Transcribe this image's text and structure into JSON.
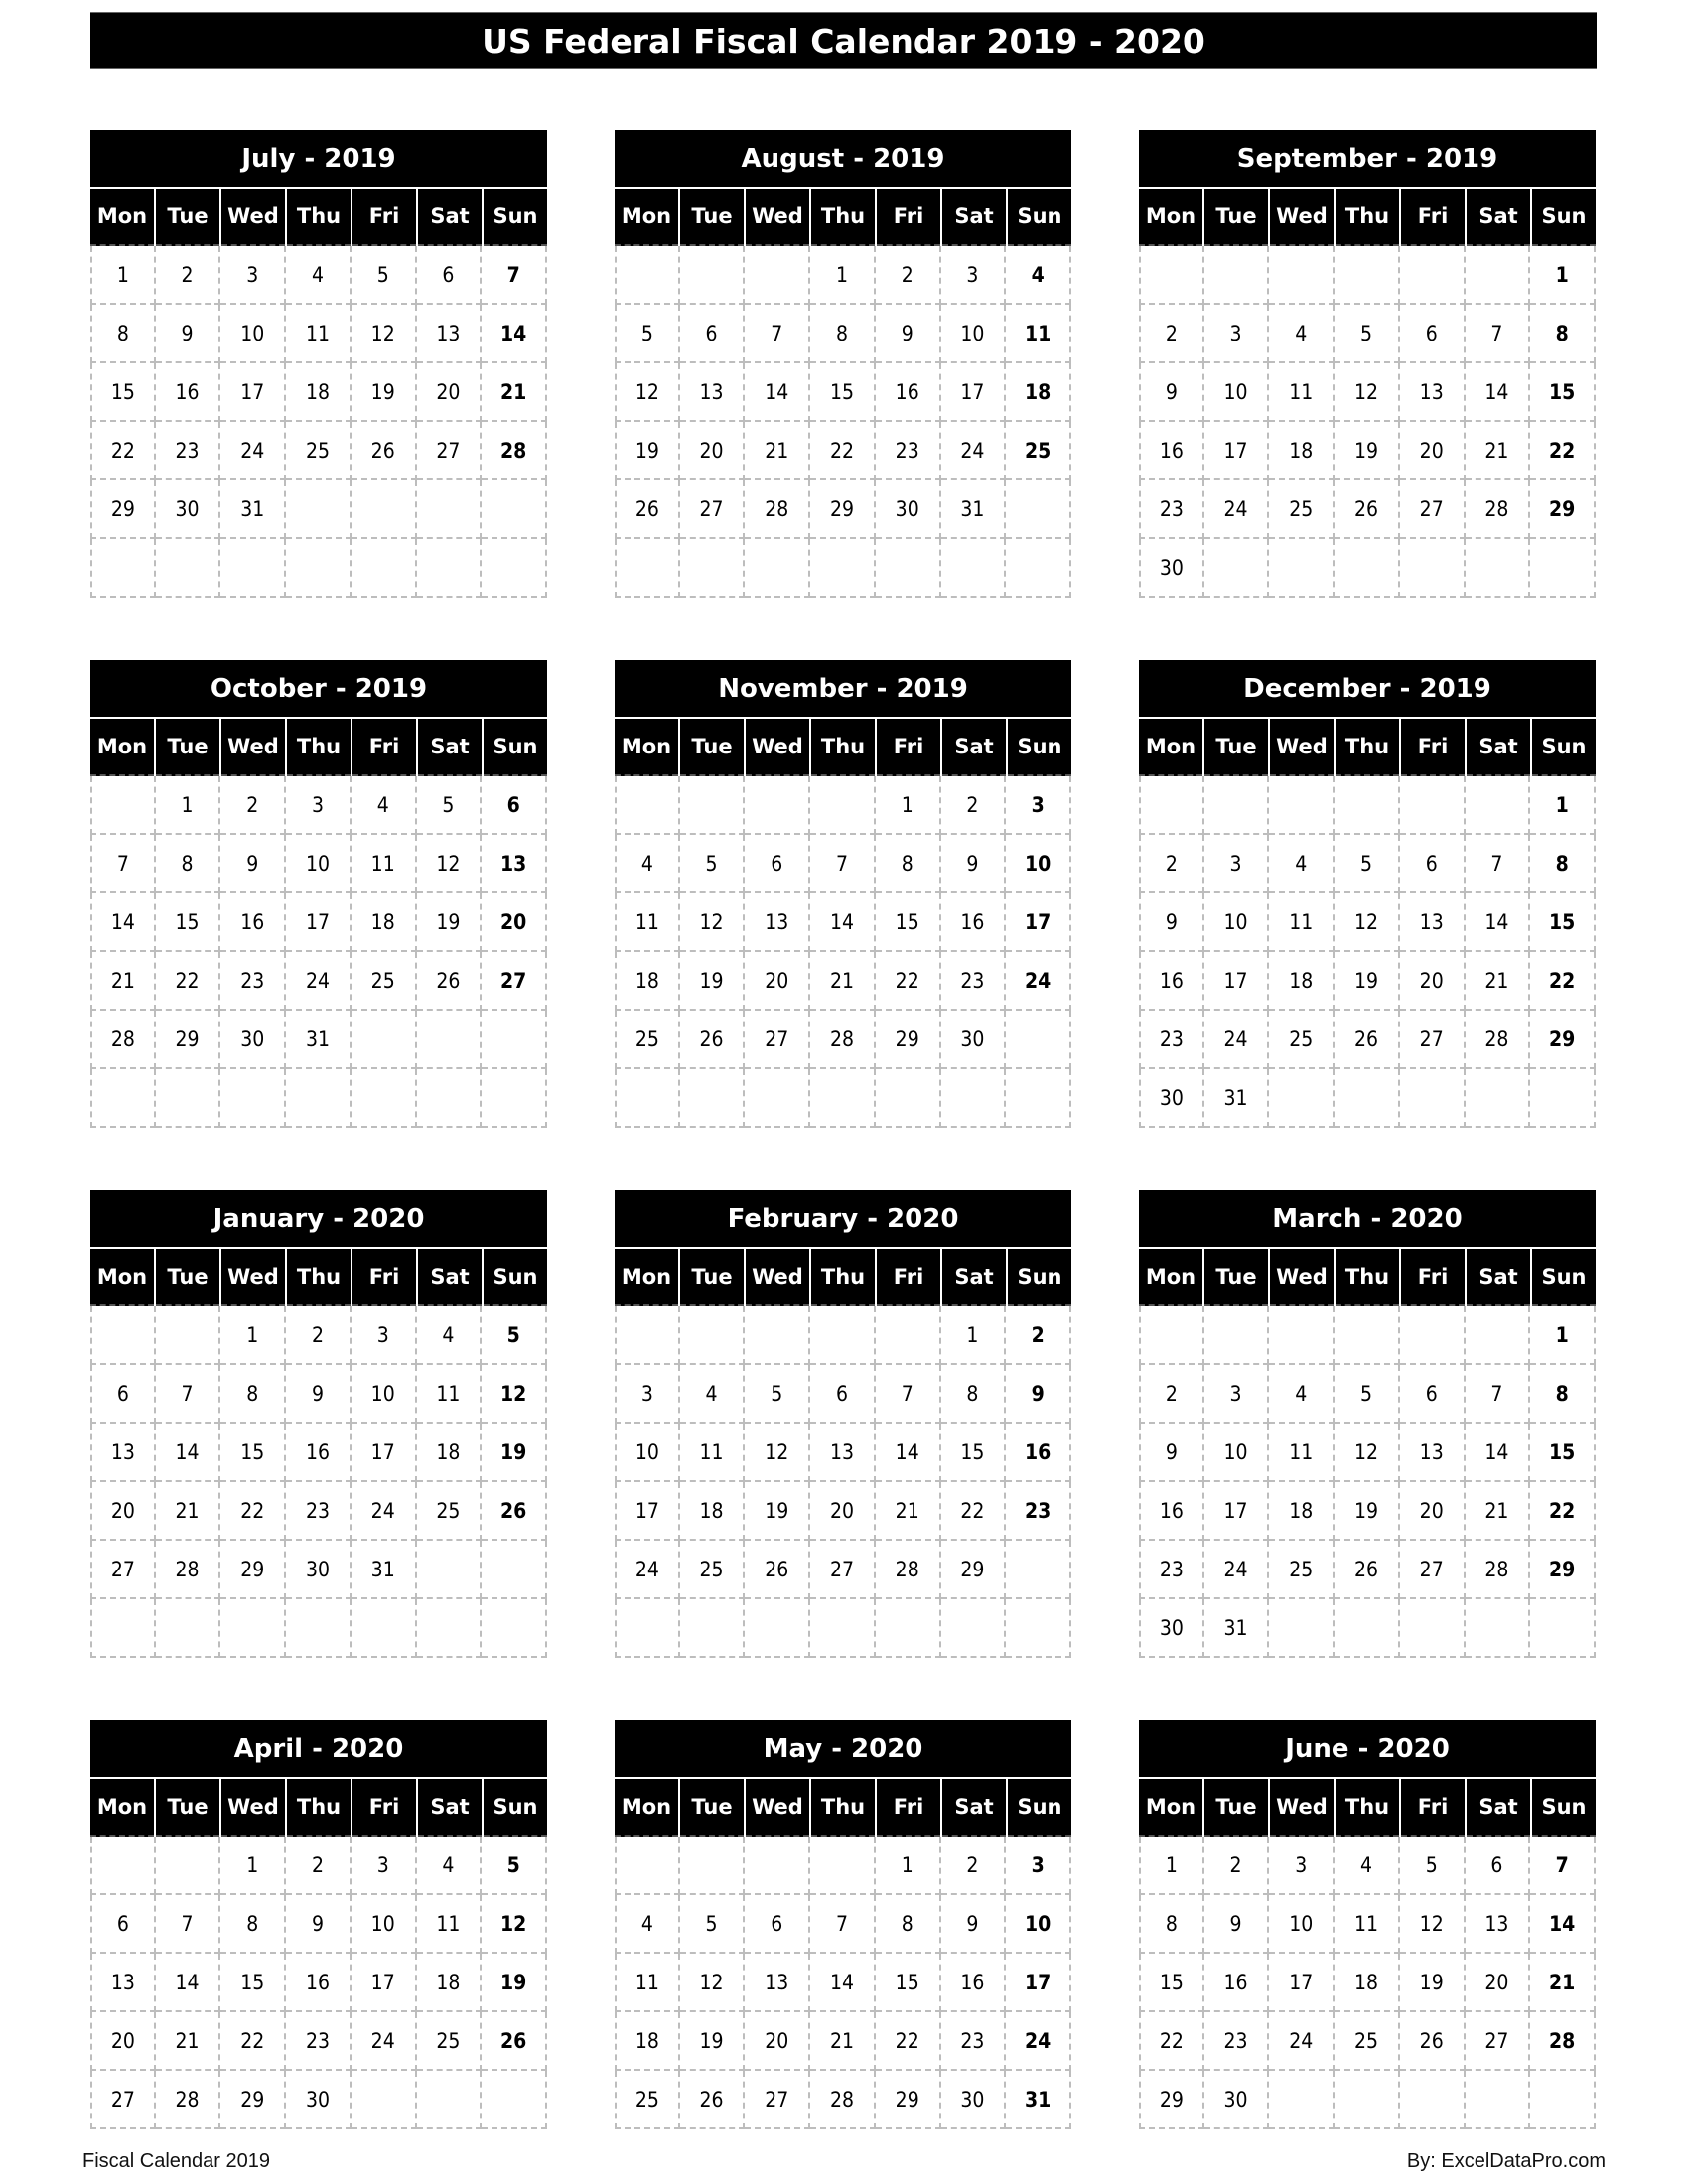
{
  "title": "US Federal Fiscal Calendar 2019 - 2020",
  "weekdays": [
    "Mon",
    "Tue",
    "Wed",
    "Thu",
    "Fri",
    "Sat",
    "Sun"
  ],
  "months": [
    {
      "label": "July - 2019",
      "weeks": [
        [
          "1",
          "2",
          "3",
          "4",
          "5",
          "6",
          "7"
        ],
        [
          "8",
          "9",
          "10",
          "11",
          "12",
          "13",
          "14"
        ],
        [
          "15",
          "16",
          "17",
          "18",
          "19",
          "20",
          "21"
        ],
        [
          "22",
          "23",
          "24",
          "25",
          "26",
          "27",
          "28"
        ],
        [
          "29",
          "30",
          "31",
          "",
          "",
          "",
          ""
        ],
        [
          "",
          "",
          "",
          "",
          "",
          "",
          ""
        ]
      ]
    },
    {
      "label": "August - 2019",
      "weeks": [
        [
          "",
          "",
          "",
          "1",
          "2",
          "3",
          "4"
        ],
        [
          "5",
          "6",
          "7",
          "8",
          "9",
          "10",
          "11"
        ],
        [
          "12",
          "13",
          "14",
          "15",
          "16",
          "17",
          "18"
        ],
        [
          "19",
          "20",
          "21",
          "22",
          "23",
          "24",
          "25"
        ],
        [
          "26",
          "27",
          "28",
          "29",
          "30",
          "31",
          ""
        ],
        [
          "",
          "",
          "",
          "",
          "",
          "",
          ""
        ]
      ]
    },
    {
      "label": "September - 2019",
      "weeks": [
        [
          "",
          "",
          "",
          "",
          "",
          "",
          "1"
        ],
        [
          "2",
          "3",
          "4",
          "5",
          "6",
          "7",
          "8"
        ],
        [
          "9",
          "10",
          "11",
          "12",
          "13",
          "14",
          "15"
        ],
        [
          "16",
          "17",
          "18",
          "19",
          "20",
          "21",
          "22"
        ],
        [
          "23",
          "24",
          "25",
          "26",
          "27",
          "28",
          "29"
        ],
        [
          "30",
          "",
          "",
          "",
          "",
          "",
          ""
        ]
      ]
    },
    {
      "label": "October - 2019",
      "weeks": [
        [
          "",
          "1",
          "2",
          "3",
          "4",
          "5",
          "6"
        ],
        [
          "7",
          "8",
          "9",
          "10",
          "11",
          "12",
          "13"
        ],
        [
          "14",
          "15",
          "16",
          "17",
          "18",
          "19",
          "20"
        ],
        [
          "21",
          "22",
          "23",
          "24",
          "25",
          "26",
          "27"
        ],
        [
          "28",
          "29",
          "30",
          "31",
          "",
          "",
          ""
        ],
        [
          "",
          "",
          "",
          "",
          "",
          "",
          ""
        ]
      ]
    },
    {
      "label": "November - 2019",
      "weeks": [
        [
          "",
          "",
          "",
          "",
          "1",
          "2",
          "3"
        ],
        [
          "4",
          "5",
          "6",
          "7",
          "8",
          "9",
          "10"
        ],
        [
          "11",
          "12",
          "13",
          "14",
          "15",
          "16",
          "17"
        ],
        [
          "18",
          "19",
          "20",
          "21",
          "22",
          "23",
          "24"
        ],
        [
          "25",
          "26",
          "27",
          "28",
          "29",
          "30",
          ""
        ],
        [
          "",
          "",
          "",
          "",
          "",
          "",
          ""
        ]
      ]
    },
    {
      "label": "December - 2019",
      "weeks": [
        [
          "",
          "",
          "",
          "",
          "",
          "",
          "1"
        ],
        [
          "2",
          "3",
          "4",
          "5",
          "6",
          "7",
          "8"
        ],
        [
          "9",
          "10",
          "11",
          "12",
          "13",
          "14",
          "15"
        ],
        [
          "16",
          "17",
          "18",
          "19",
          "20",
          "21",
          "22"
        ],
        [
          "23",
          "24",
          "25",
          "26",
          "27",
          "28",
          "29"
        ],
        [
          "30",
          "31",
          "",
          "",
          "",
          "",
          ""
        ]
      ]
    },
    {
      "label": "January - 2020",
      "weeks": [
        [
          "",
          "",
          "1",
          "2",
          "3",
          "4",
          "5"
        ],
        [
          "6",
          "7",
          "8",
          "9",
          "10",
          "11",
          "12"
        ],
        [
          "13",
          "14",
          "15",
          "16",
          "17",
          "18",
          "19"
        ],
        [
          "20",
          "21",
          "22",
          "23",
          "24",
          "25",
          "26"
        ],
        [
          "27",
          "28",
          "29",
          "30",
          "31",
          "",
          ""
        ],
        [
          "",
          "",
          "",
          "",
          "",
          "",
          ""
        ]
      ]
    },
    {
      "label": "February - 2020",
      "weeks": [
        [
          "",
          "",
          "",
          "",
          "",
          "1",
          "2"
        ],
        [
          "3",
          "4",
          "5",
          "6",
          "7",
          "8",
          "9"
        ],
        [
          "10",
          "11",
          "12",
          "13",
          "14",
          "15",
          "16"
        ],
        [
          "17",
          "18",
          "19",
          "20",
          "21",
          "22",
          "23"
        ],
        [
          "24",
          "25",
          "26",
          "27",
          "28",
          "29",
          ""
        ],
        [
          "",
          "",
          "",
          "",
          "",
          "",
          ""
        ]
      ]
    },
    {
      "label": "March - 2020",
      "weeks": [
        [
          "",
          "",
          "",
          "",
          "",
          "",
          "1"
        ],
        [
          "2",
          "3",
          "4",
          "5",
          "6",
          "7",
          "8"
        ],
        [
          "9",
          "10",
          "11",
          "12",
          "13",
          "14",
          "15"
        ],
        [
          "16",
          "17",
          "18",
          "19",
          "20",
          "21",
          "22"
        ],
        [
          "23",
          "24",
          "25",
          "26",
          "27",
          "28",
          "29"
        ],
        [
          "30",
          "31",
          "",
          "",
          "",
          "",
          ""
        ]
      ]
    },
    {
      "label": "April - 2020",
      "weeks": [
        [
          "",
          "",
          "1",
          "2",
          "3",
          "4",
          "5"
        ],
        [
          "6",
          "7",
          "8",
          "9",
          "10",
          "11",
          "12"
        ],
        [
          "13",
          "14",
          "15",
          "16",
          "17",
          "18",
          "19"
        ],
        [
          "20",
          "21",
          "22",
          "23",
          "24",
          "25",
          "26"
        ],
        [
          "27",
          "28",
          "29",
          "30",
          "",
          "",
          ""
        ]
      ]
    },
    {
      "label": "May - 2020",
      "weeks": [
        [
          "",
          "",
          "",
          "",
          "1",
          "2",
          "3"
        ],
        [
          "4",
          "5",
          "6",
          "7",
          "8",
          "9",
          "10"
        ],
        [
          "11",
          "12",
          "13",
          "14",
          "15",
          "16",
          "17"
        ],
        [
          "18",
          "19",
          "20",
          "21",
          "22",
          "23",
          "24"
        ],
        [
          "25",
          "26",
          "27",
          "28",
          "29",
          "30",
          "31"
        ]
      ]
    },
    {
      "label": "June - 2020",
      "weeks": [
        [
          "1",
          "2",
          "3",
          "4",
          "5",
          "6",
          "7"
        ],
        [
          "8",
          "9",
          "10",
          "11",
          "12",
          "13",
          "14"
        ],
        [
          "15",
          "16",
          "17",
          "18",
          "19",
          "20",
          "21"
        ],
        [
          "22",
          "23",
          "24",
          "25",
          "26",
          "27",
          "28"
        ],
        [
          "29",
          "30",
          "",
          "",
          "",
          "",
          ""
        ]
      ]
    }
  ],
  "footer": {
    "left": "Fiscal Calendar 2019",
    "right": "By: ExcelDataPro.com"
  }
}
